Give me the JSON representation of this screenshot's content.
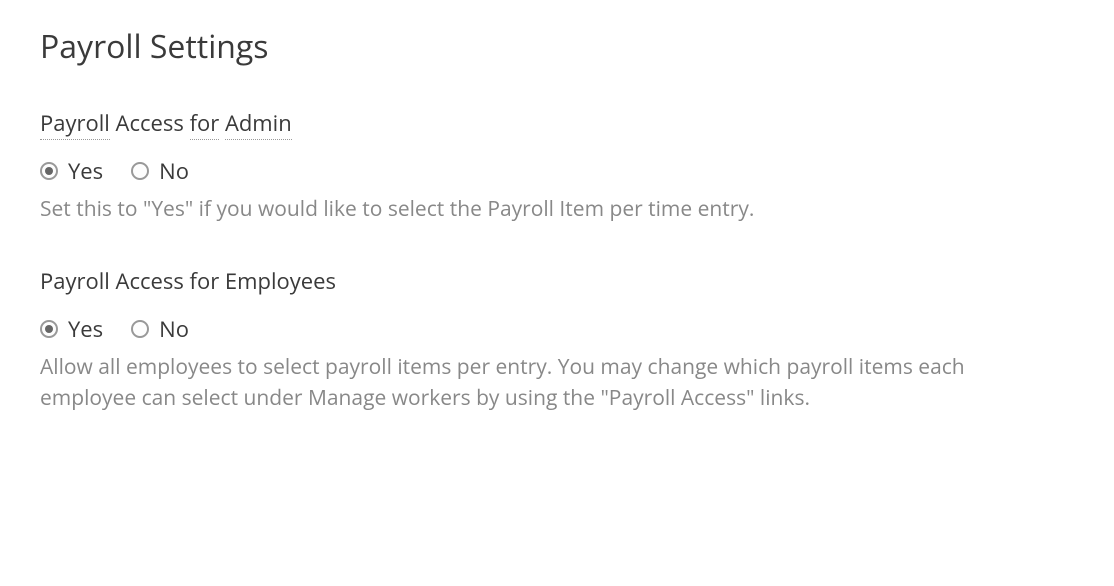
{
  "page": {
    "title": "Payroll Settings"
  },
  "sections": {
    "admin": {
      "title_parts": [
        "Payroll",
        " Access ",
        "for",
        " ",
        "Admin"
      ],
      "options": {
        "yes": "Yes",
        "no": "No"
      },
      "selected": "yes",
      "help": "Set this to \"Yes\" if you would like to select the Payroll Item per time entry."
    },
    "employees": {
      "title": "Payroll Access for Employees",
      "options": {
        "yes": "Yes",
        "no": "No"
      },
      "selected": "yes",
      "help": "Allow all employees to select payroll items per entry. You may change which payroll items each employee can select under Manage workers by using the \"Payroll Access\" links."
    }
  }
}
